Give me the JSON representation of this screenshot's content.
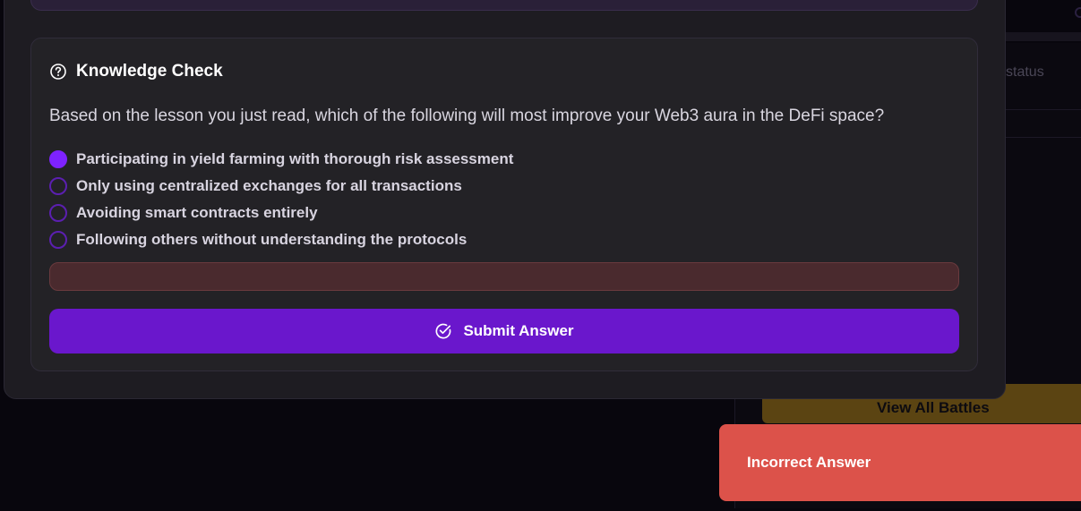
{
  "background": {
    "status_text": "status",
    "view_all_battles": "View All Battles"
  },
  "knowledge_check": {
    "icon": "question-circle-icon",
    "title": "Knowledge Check",
    "question": "Based on the lesson you just read, which of the following will most improve your Web3 aura in the DeFi space?",
    "options": [
      {
        "label": "Participating in yield farming with thorough risk assessment",
        "selected": true
      },
      {
        "label": "Only using centralized exchanges for all transactions",
        "selected": false
      },
      {
        "label": "Avoiding smart contracts entirely",
        "selected": false
      },
      {
        "label": "Following others without understanding the protocols",
        "selected": false
      }
    ],
    "feedback_text": "",
    "submit_icon": "check-circle-icon",
    "submit_label": "Submit Answer"
  },
  "toast": {
    "message": "Incorrect Answer"
  },
  "colors": {
    "accent": "#6a17cc",
    "radio_selected": "#7e22ff",
    "toast_error": "#dc524a",
    "battles_button": "#5b4412"
  }
}
